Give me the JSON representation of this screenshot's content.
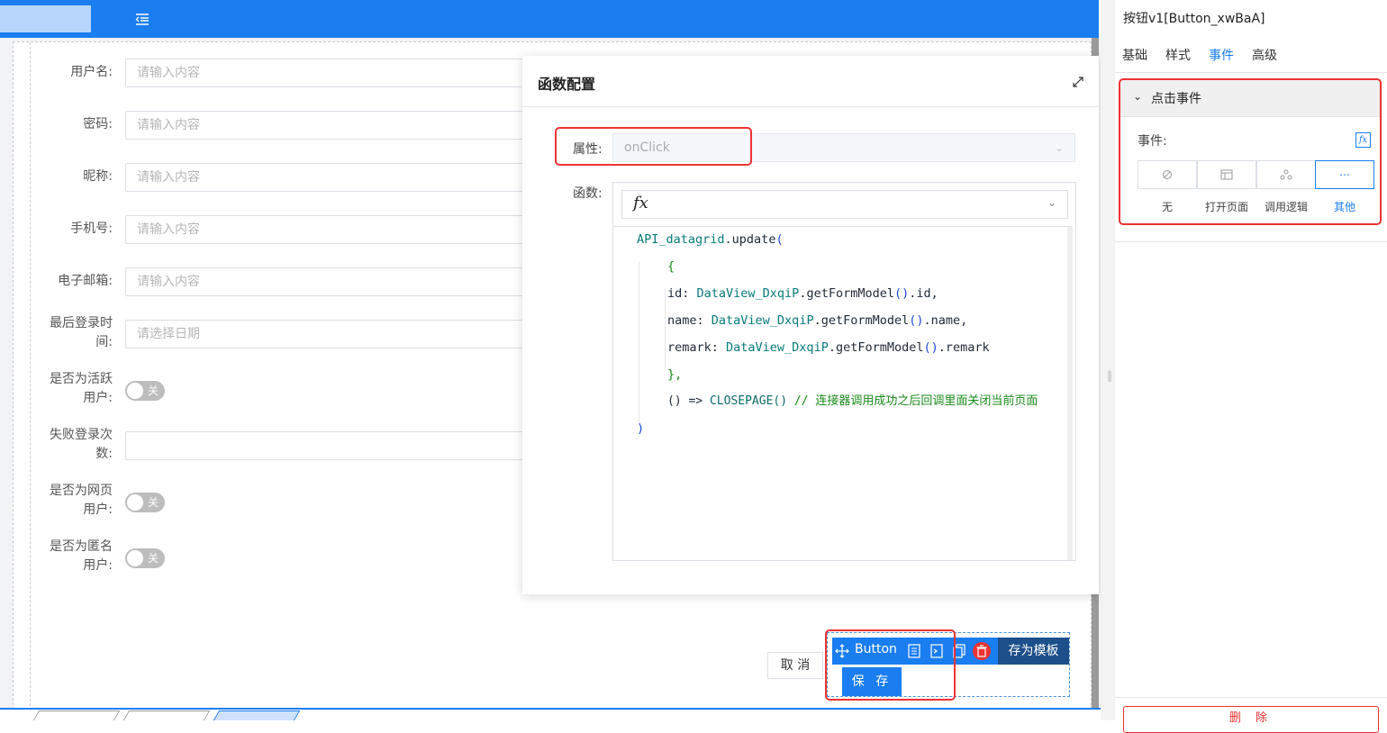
{
  "topbar": {
    "menu_icon": "menu-fold-icon",
    "accent": "#1a7df0"
  },
  "form": {
    "fields": [
      {
        "label": "用户名:",
        "placeholder": "请输入内容"
      },
      {
        "label": "密码:",
        "placeholder": "请输入内容"
      },
      {
        "label": "昵称:",
        "placeholder": "请输入内容"
      },
      {
        "label": "手机号:",
        "placeholder": "请输入内容"
      },
      {
        "label": "电子邮箱:",
        "placeholder": "请输入内容"
      },
      {
        "label_line1": "最后登录时",
        "label_line2": "间:",
        "placeholder": "请选择日期"
      }
    ],
    "toggles": [
      {
        "label_line1": "是否为活跃",
        "label_line2": "用户:",
        "state": "关"
      },
      {
        "label_line1": "是否为网页",
        "label_line2": "用户:",
        "state": "关"
      },
      {
        "label_line1": "是否为匿名",
        "label_line2": "用户:",
        "state": "关"
      }
    ],
    "failed_login": {
      "label_line1": "失败登录次",
      "label_line2": "数:"
    },
    "cancel_label": "取 消",
    "save_label": "保 存"
  },
  "dialog": {
    "title": "函数配置",
    "property_label": "属性:",
    "property_value": "onClick",
    "function_label": "函数:",
    "fx_symbol": "fx",
    "code": {
      "l1_obj": "API_datagrid",
      "l1_rest": ".update",
      "l1_paren": "(",
      "l2": "{",
      "l3_key": "id: ",
      "l3_obj": "DataView_DxqiP",
      "l3_method": ".getFormModel",
      "l3_paren": "()",
      "l3_tail": ".id,",
      "l4_key": "name: ",
      "l4_obj": "DataView_DxqiP",
      "l4_method": ".getFormModel",
      "l4_paren": "()",
      "l4_tail": ".name,",
      "l5_key": "remark: ",
      "l5_obj": "DataView_DxqiP",
      "l5_method": ".getFormModel",
      "l5_paren": "()",
      "l5_tail": ".remark",
      "l6": "},",
      "l7_arrow": "() => ",
      "l7_fn": "CLOSEPAGE()",
      "l7_comment": " // 连接器调用成功之后回调里面关闭当前页面",
      "l8": ")"
    }
  },
  "button_toolbar": {
    "label": "Button",
    "save_template": "存为模板"
  },
  "right_panel": {
    "title": "按钮v1[Button_xwBaA]",
    "tabs": [
      "基础",
      "样式",
      "事件",
      "高级"
    ],
    "active_tab": "事件",
    "accordion_title": "点击事件",
    "events_label": "事件:",
    "event_options": [
      {
        "icon": "ban-icon",
        "label": "无"
      },
      {
        "icon": "layout-icon",
        "label": "打开页面"
      },
      {
        "icon": "logic-icon",
        "label": "调用逻辑"
      },
      {
        "icon": "ellipsis-icon",
        "label": "其他"
      }
    ],
    "active_event": "其他",
    "delete_label": "删 除"
  },
  "colors": {
    "primary": "#1a7df0",
    "danger": "#e33333",
    "dark_blue": "#1d4f8a"
  }
}
